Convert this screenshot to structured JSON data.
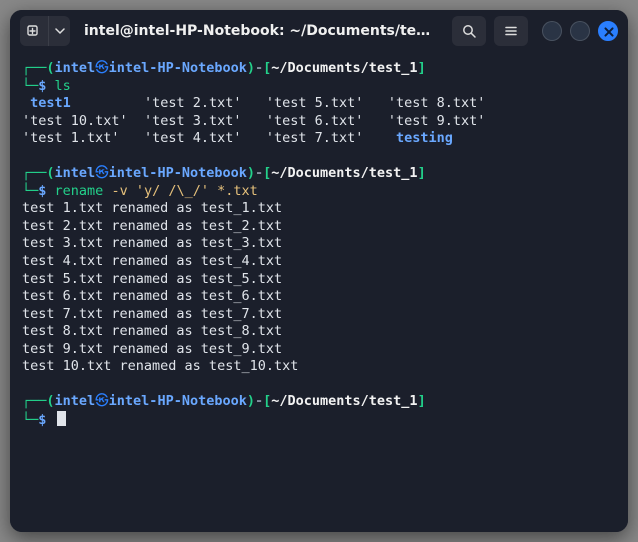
{
  "window": {
    "title": "intel@intel-HP-Notebook: ~/Documents/tes..."
  },
  "prompt": {
    "corner_top": "┌──",
    "corner_bot": "└─",
    "open": "(",
    "close": ")",
    "user": "intel",
    "at": "㉿",
    "host": "intel-HP-Notebook",
    "dash": "-",
    "lb": "[",
    "rb": "]",
    "path": "~/Documents/test_1",
    "dollar": "$"
  },
  "blocks": [
    {
      "cmd": "ls",
      "args": "",
      "output_rows": [
        [
          {
            "text": " test1",
            "cls": "blu"
          },
          {
            "text": "         ",
            "cls": "whtn"
          },
          {
            "text": "'test 2.txt'",
            "cls": "whtn"
          },
          {
            "text": "   ",
            "cls": "whtn"
          },
          {
            "text": "'test 5.txt'",
            "cls": "whtn"
          },
          {
            "text": "   ",
            "cls": "whtn"
          },
          {
            "text": "'test 8.txt'",
            "cls": "whtn"
          }
        ],
        [
          {
            "text": "'test 10.txt'",
            "cls": "whtn"
          },
          {
            "text": "  ",
            "cls": "whtn"
          },
          {
            "text": "'test 3.txt'",
            "cls": "whtn"
          },
          {
            "text": "   ",
            "cls": "whtn"
          },
          {
            "text": "'test 6.txt'",
            "cls": "whtn"
          },
          {
            "text": "   ",
            "cls": "whtn"
          },
          {
            "text": "'test 9.txt'",
            "cls": "whtn"
          }
        ],
        [
          {
            "text": "'test 1.txt'",
            "cls": "whtn"
          },
          {
            "text": "   ",
            "cls": "whtn"
          },
          {
            "text": "'test 4.txt'",
            "cls": "whtn"
          },
          {
            "text": "   ",
            "cls": "whtn"
          },
          {
            "text": "'test 7.txt'",
            "cls": "whtn"
          },
          {
            "text": "    ",
            "cls": "whtn"
          },
          {
            "text": "testing",
            "cls": "blu"
          }
        ]
      ]
    },
    {
      "cmd": "rename",
      "args": " -v 'y/ /\\_/' *.txt",
      "output_rows": [
        [
          {
            "text": "test 1.txt renamed as test_1.txt",
            "cls": "whtn"
          }
        ],
        [
          {
            "text": "test 2.txt renamed as test_2.txt",
            "cls": "whtn"
          }
        ],
        [
          {
            "text": "test 3.txt renamed as test_3.txt",
            "cls": "whtn"
          }
        ],
        [
          {
            "text": "test 4.txt renamed as test_4.txt",
            "cls": "whtn"
          }
        ],
        [
          {
            "text": "test 5.txt renamed as test_5.txt",
            "cls": "whtn"
          }
        ],
        [
          {
            "text": "test 6.txt renamed as test_6.txt",
            "cls": "whtn"
          }
        ],
        [
          {
            "text": "test 7.txt renamed as test_7.txt",
            "cls": "whtn"
          }
        ],
        [
          {
            "text": "test 8.txt renamed as test_8.txt",
            "cls": "whtn"
          }
        ],
        [
          {
            "text": "test 9.txt renamed as test_9.txt",
            "cls": "whtn"
          }
        ],
        [
          {
            "text": "test 10.txt renamed as test_10.txt",
            "cls": "whtn"
          }
        ]
      ]
    },
    {
      "cmd": "",
      "args": "",
      "output_rows": [],
      "cursor": true
    }
  ]
}
